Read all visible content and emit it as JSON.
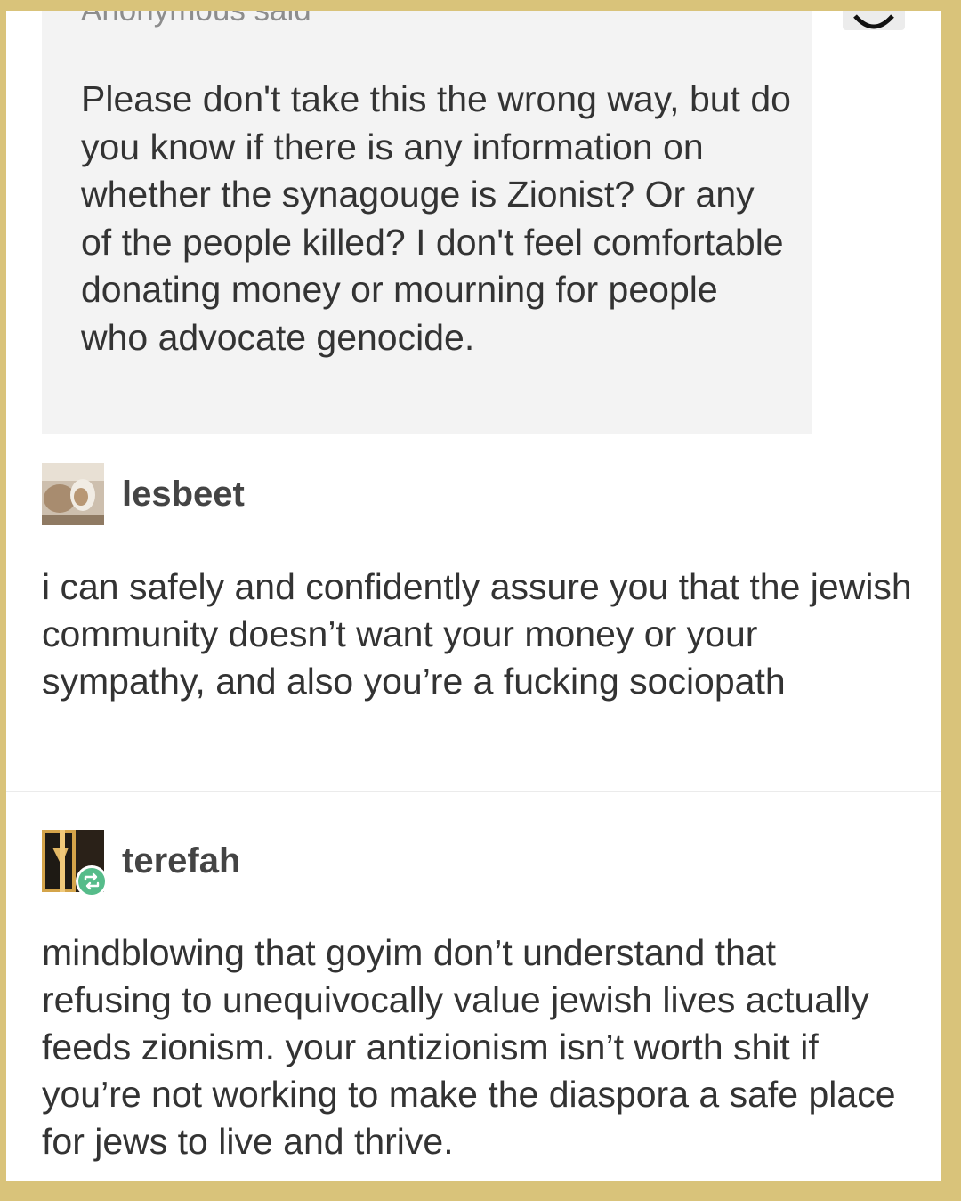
{
  "ask": {
    "header": "Anonymous said",
    "text": "Please don't take this the wrong way, but do you know if there is any information on whether the synagouge is Zionist? Or any of the people killed? I don't feel comfortable donating money or mourning for people who advocate genocide.",
    "avatar_icon": "anonymous-avatar-icon"
  },
  "posts": [
    {
      "username": "lesbeet",
      "avatar_icon": "user-avatar-photo",
      "text": "i can safely and confidently assure you that the jewish community doesn’t want your money or your sympathy, and also you’re a fucking sociopath"
    },
    {
      "username": "terefah",
      "avatar_icon": "user-avatar-photo",
      "badge_icon": "reblog-icon",
      "text": "mindblowing that goyim don’t understand that refusing to unequivocally value jewish lives actually feeds zionism. your antizionism isn’t worth shit if you’re not working to make the diaspora a safe place for jews to live and thrive."
    }
  ],
  "colors": {
    "frame_border": "#d9c37a",
    "ask_background": "#f3f3f3",
    "reblog_badge": "#56bc8a",
    "text": "#333333"
  }
}
